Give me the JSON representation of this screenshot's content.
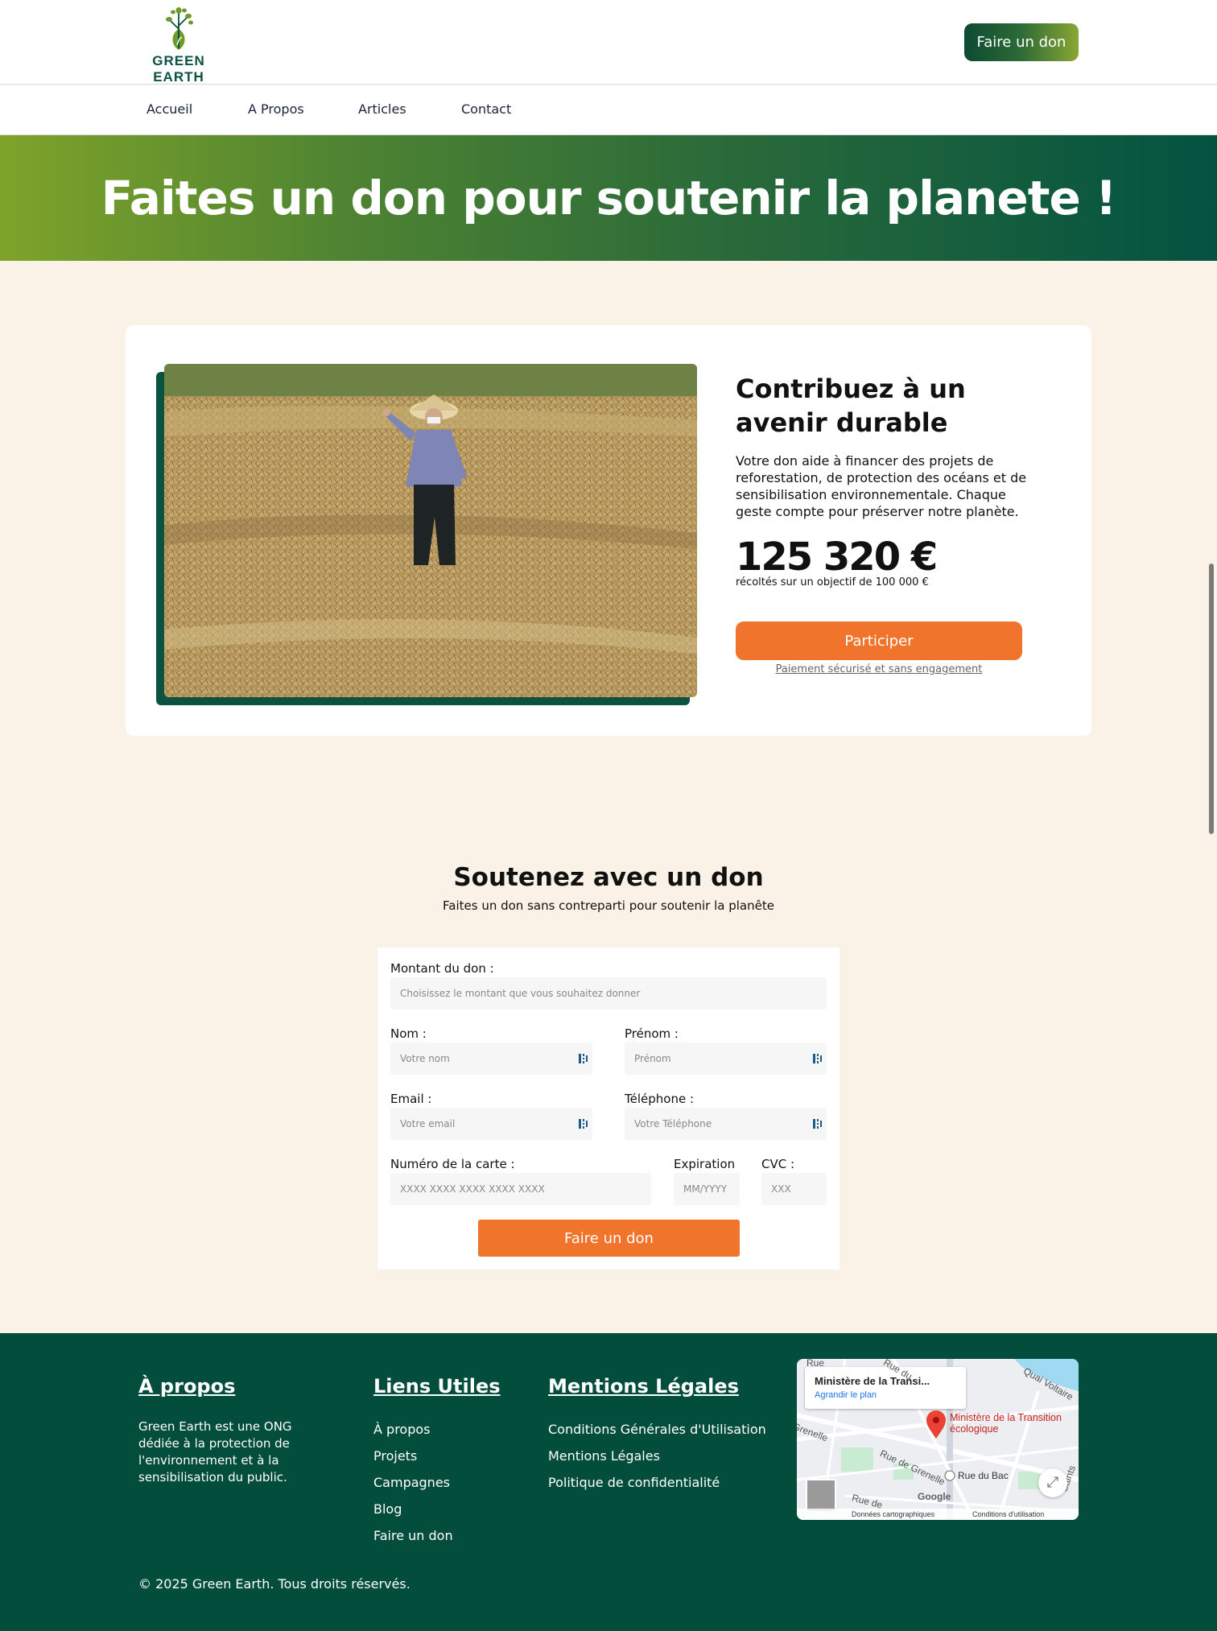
{
  "header": {
    "logo_text": "GREEN EARTH",
    "donate_button": "Faire un don"
  },
  "nav": {
    "items": [
      "Accueil",
      "A Propos",
      "Articles",
      "Contact"
    ]
  },
  "hero": {
    "title": "Faites un don pour soutenir la planete !"
  },
  "card": {
    "title": "Contribuez à un avenir durable",
    "text": "Votre don aide à financer des projets de reforestation, de protection des océans et de sensibilisation environnementale. Chaque geste compte pour préserver notre planète.",
    "amount": "125 320 €",
    "amount_sub": "récoltés sur un objectif de 100 000 €",
    "button": "Participer",
    "secure_note": "Paiement sécurisé et sans engagement"
  },
  "form_section": {
    "title": "Soutenez avec un don",
    "subtitle": "Faites un don sans contreparti pour soutenir la planête",
    "fields": {
      "amount": {
        "label": "Montant du don :",
        "placeholder": "Choisissez le montant que vous souhaitez donner"
      },
      "nom": {
        "label": "Nom :",
        "placeholder": "Votre nom"
      },
      "prenom": {
        "label": "Prénom :",
        "placeholder": "Prénom"
      },
      "email": {
        "label": "Email :",
        "placeholder": "Votre email"
      },
      "phone": {
        "label": "Téléphone :",
        "placeholder": "Votre Téléphone"
      },
      "card_number": {
        "label": "Numéro de la carte :",
        "placeholder": "XXXX XXXX XXXX XXXX XXXX"
      },
      "expiration": {
        "label": "Expiration",
        "placeholder": "MM/YYYY"
      },
      "cvc": {
        "label": "CVC :",
        "placeholder": "XXX"
      }
    },
    "submit": "Faire un don"
  },
  "footer": {
    "about_heading": "À propos",
    "about_text": "Green Earth est une ONG dédiée à la protection de l'environnement et à la sensibilisation du public.",
    "links_heading": "Liens Utiles",
    "links": [
      "À propos",
      "Projets",
      "Campagnes",
      "Blog",
      "Faire un don"
    ],
    "legal_heading": "Mentions Légales",
    "legal_links": [
      "Conditions Générales d'Utilisation",
      "Mentions Légales",
      "Politique de confidentialité"
    ],
    "copyright": "© 2025 Green Earth. Tous droits réservés.",
    "map": {
      "place_title": "Ministère de la Transi...",
      "enlarge_link": "Agrandir le plan",
      "pin_label": "Ministère de la Transition écologique",
      "street_1": "Rue du Bac",
      "street_2": "Quai Voltaire",
      "street_3": "Rue de Grenelle",
      "street_4": "Grenelle",
      "street_5": "Rue de",
      "street_6": "Rue",
      "street_7": "des Saints",
      "street_8": "Rue du",
      "data_label": "Données cartographiques",
      "terms_label": "Conditions d'utilisation",
      "brand": "Google"
    }
  },
  "colors": {
    "brand_green": "#024d3b",
    "accent_orange": "#f0742b",
    "hero_start": "#7fa32a",
    "cream_bg": "#fbf2e7"
  }
}
